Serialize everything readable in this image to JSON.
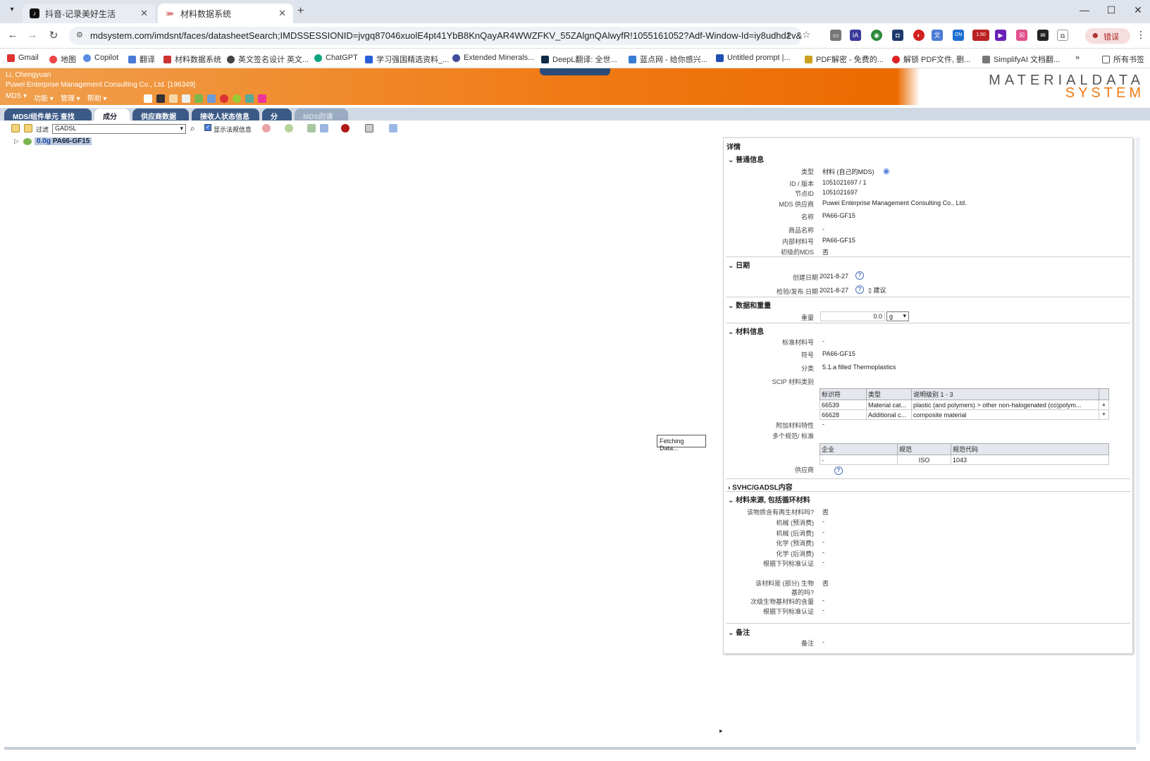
{
  "browser": {
    "tabs": [
      {
        "title": "抖音-记录美好生活"
      },
      {
        "title": "材料数据系统"
      }
    ],
    "url": "mdsystem.com/imdsnt/faces/datasheetSearch;IMDSSESSIONID=jvgq87046xuolE4pt41YbB8KnQayAR4WWZFKV_55ZAlgnQAlwyfR!1055161052?Adf-Window-Id=iy8udhd2v&Adf-...",
    "profile_label": "错误",
    "ext_badge": "1.50",
    "bookmarks": [
      "Gmail",
      "地图",
      "Copilot",
      "翻译",
      "材料数据系统",
      "英文签名设计 英文...",
      "ChatGPT",
      "学习强国精选资料_...",
      "Extended Minerals...",
      "DeepL翻译: 全世...",
      "蓝点网 - 给你感兴...",
      "Untitled prompt |...",
      "PDF解密 - 免费的...",
      "解锁 PDF文件, 删...",
      "SimplifyAI 文档翻..."
    ],
    "all_bookmarks": "所有书签",
    "more": "»"
  },
  "app": {
    "user": "Li, Chengyuan",
    "company": "Puwei Enterprise Management Consulting Co., Ltd. [196349]",
    "logo_line1": "MATERIALDATA",
    "logo_line2": "SYSTEM",
    "menus": [
      "MDS ▾",
      "功能 ▾",
      "管理 ▾",
      "帮助 ▾"
    ],
    "tabs": [
      "MDS/组件单元 查找",
      "成分 *",
      "供应商数据 *",
      "接收人状态信息 *",
      "分析",
      "MDS的请求"
    ],
    "toolbar": {
      "filter_label": "过滤",
      "filter_value": "GADSL",
      "show_laws": "显示法规信息"
    },
    "tree_item": {
      "weight": "0.0g",
      "name": "PA66-GF15"
    },
    "fetching": "Fetching Data..."
  },
  "detail": {
    "title": "详情",
    "general": {
      "heading": "普通信息",
      "rows": [
        {
          "label": "类型",
          "value": "材料 (自己的MDS)"
        },
        {
          "label": "ID / 版本",
          "value": "1051021697 / 1"
        },
        {
          "label": "节点ID",
          "value": "1051021697"
        },
        {
          "label": "MDS 供应商",
          "value": "Puwei Enterprise Management Consulting Co., Ltd."
        },
        {
          "label": "名称",
          "value": "PA66-GF15"
        },
        {
          "label": "商品名称",
          "value": "-"
        },
        {
          "label": "内部材料号",
          "value": "PA66-GF15"
        },
        {
          "label": "初级的MDS",
          "value": "否"
        }
      ]
    },
    "dates": {
      "heading": "日期",
      "created_label": "创建日期",
      "created_value": "2021-8-27",
      "checked_label": "检验/发布 日期",
      "checked_value": "2021-8-27",
      "suggest": "建议"
    },
    "quantity": {
      "heading": "数据和重量",
      "weight_label": "重量",
      "weight_value": "0.0",
      "unit": "g"
    },
    "material": {
      "heading": "材料信息",
      "std_label": "标准材料号",
      "std_value": "-",
      "symbol_label": "符号",
      "symbol_value": "PA66-GF15",
      "class_label": "分类",
      "class_value": "5.1.a filled Thermoplastics",
      "scip_label": "SCIP 材料类别",
      "scip_headers": [
        "标识符",
        "类型",
        "说明级别 1 - 3"
      ],
      "scip_rows": [
        [
          "66539",
          "Material cat...",
          "plastic (and polymers) > other non-halogenated (co)polym..."
        ],
        [
          "66628",
          "Additional c...",
          "composite material"
        ]
      ],
      "extra_label": "附加材料特性",
      "extra_value": "-",
      "norms_label": "多个规范/ 标准",
      "norms_headers": [
        "企业",
        "规范",
        "规范代码"
      ],
      "norms_rows": [
        [
          "-",
          "ISO",
          "1043"
        ]
      ],
      "supplier_label": "供应商"
    },
    "svhc": {
      "heading": "SVHC/GADSL内容"
    },
    "source": {
      "heading": "材料来源, 包括循环材料",
      "rows": [
        {
          "label": "该物质含有再生材料吗?",
          "value": "否"
        },
        {
          "label": "机械 (预消费)",
          "value": "-"
        },
        {
          "label": "机械 (后消费)",
          "value": "-"
        },
        {
          "label": "化学 (预消费)",
          "value": "-"
        },
        {
          "label": "化学 (后消费)",
          "value": "-"
        },
        {
          "label": "根据下列标准认证",
          "value": "-"
        }
      ],
      "bio_label": "该材料是 (部分) 生物基的吗?",
      "bio_value": "否",
      "bio_rows": [
        {
          "label": "次级生物基材料的含量",
          "value": "-"
        },
        {
          "label": "根据下列标准认证",
          "value": "-"
        }
      ]
    },
    "remarks": {
      "heading": "备注",
      "label": "备注",
      "value": "-"
    }
  }
}
